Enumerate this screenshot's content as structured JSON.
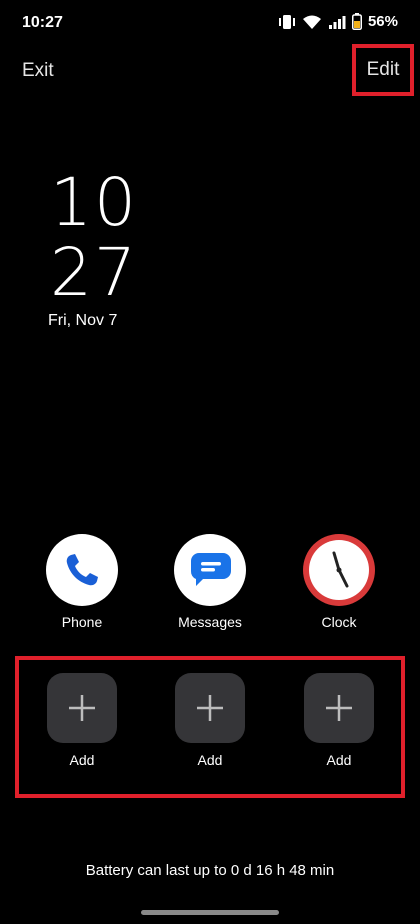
{
  "status_bar": {
    "time": "10:27",
    "battery_percent": "56%"
  },
  "header": {
    "exit_label": "Exit",
    "edit_label": "Edit"
  },
  "lock_clock": {
    "hour": "10",
    "minute": "27",
    "date": "Fri, Nov 7"
  },
  "apps": [
    {
      "label": "Phone",
      "icon": "phone-icon"
    },
    {
      "label": "Messages",
      "icon": "messages-icon"
    },
    {
      "label": "Clock",
      "icon": "clock-icon"
    }
  ],
  "shortcuts": [
    {
      "label": "Add",
      "icon": "plus-icon"
    },
    {
      "label": "Add",
      "icon": "plus-icon"
    },
    {
      "label": "Add",
      "icon": "plus-icon"
    }
  ],
  "footer": {
    "battery_note": "Battery can last up to 0 d 16 h 48 min"
  },
  "colors": {
    "highlight": "#e0202b",
    "background": "#000000",
    "tile": "#353538",
    "clock_ring": "#d93a3a",
    "phone_blue": "#1a5fd6",
    "messages_blue": "#1a73e8"
  }
}
